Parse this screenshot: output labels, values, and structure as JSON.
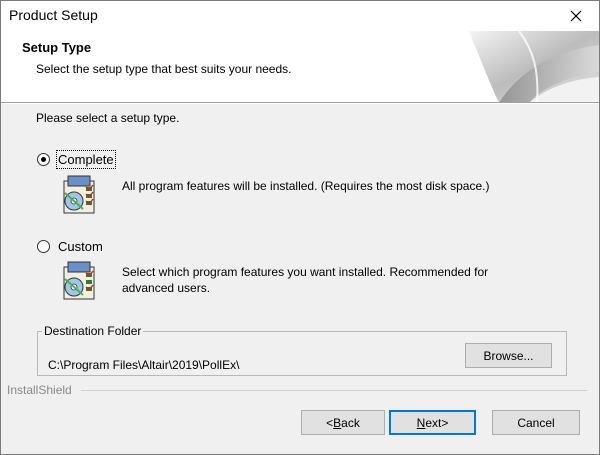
{
  "window": {
    "title": "Product Setup"
  },
  "header": {
    "title": "Setup Type",
    "subtitle": "Select the setup type that best suits your needs."
  },
  "prompt": "Please select a setup type.",
  "options": [
    {
      "label": "Complete",
      "checked": true,
      "description": "All program features will be installed. (Requires the most disk space.)"
    },
    {
      "label": "Custom",
      "checked": false,
      "description_line1": "Select which program features you want installed. Recommended for",
      "description_line2": "advanced users."
    }
  ],
  "destination": {
    "legend": "Destination Folder",
    "path": "C:\\Program Files\\Altair\\2019\\PollEx\\",
    "browse": "Browse..."
  },
  "footer": {
    "brand": "InstallShield",
    "back_prefix": "< ",
    "back_hotkey": "B",
    "back_rest": "ack",
    "next_hotkey": "N",
    "next_rest": "ext",
    "next_suffix": " >",
    "cancel": "Cancel"
  },
  "colors": {
    "accent": "#0078d7",
    "window_bg": "#f0f0f0"
  }
}
